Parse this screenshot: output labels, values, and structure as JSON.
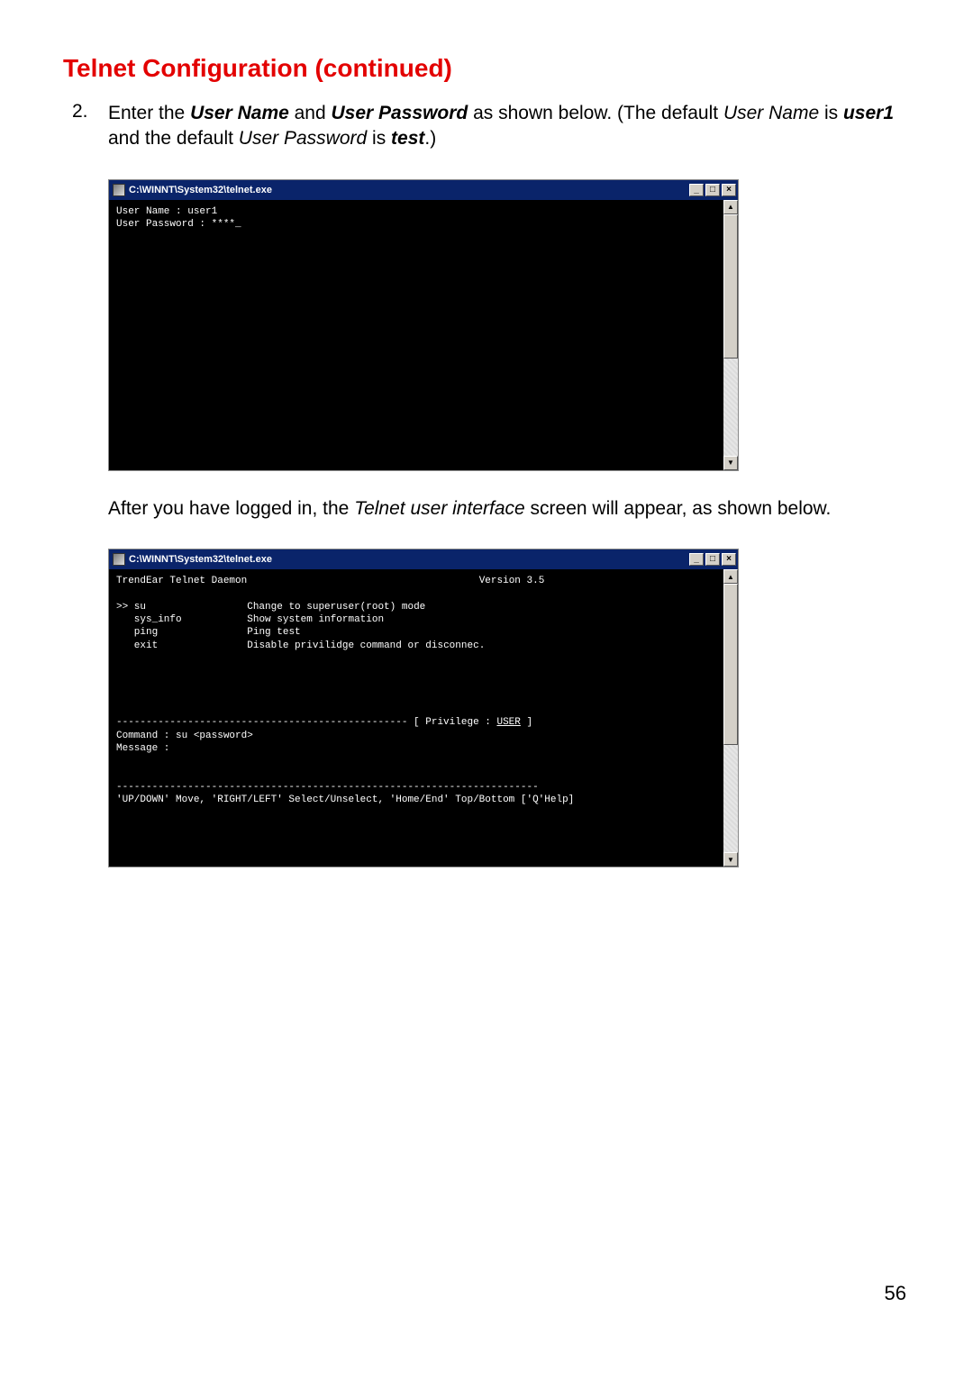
{
  "heading": "Telnet Configuration (continued)",
  "step_num": "2.",
  "step_text_parts": {
    "t1": "Enter the ",
    "b1": "User Name",
    "t2": " and ",
    "b2": "User Password",
    "t3": " as shown below. (The default ",
    "i1": "User Name",
    "t4": " is ",
    "bi1": "user1",
    "t5": " and the default ",
    "i2": "User Password",
    "t6": " is ",
    "bi2": "test",
    "t7": ".)"
  },
  "window1": {
    "title": "C:\\WINNT\\System32\\telnet.exe",
    "lines": {
      "l1": "User Name : user1",
      "l2": "User Password : ****_"
    }
  },
  "para_parts": {
    "t1": "After you have logged in, the ",
    "i1": "Telnet user interface",
    "t2": " screen will appear, as shown below."
  },
  "window2": {
    "title": "C:\\WINNT\\System32\\telnet.exe",
    "header_left": "TrendEar Telnet Daemon",
    "header_right": "Version 3.5",
    "cmds": {
      "c1": ">> su",
      "d1": "Change to superuser(root) mode",
      "c2": "   sys_info",
      "d2": "Show system information",
      "c3": "   ping",
      "d3": "Ping test",
      "c4": "   exit",
      "d4": "Disable privilidge command or disconnec."
    },
    "priv_line": "------------------------------------------------- [ Privilege : ",
    "priv_value": "USER",
    "priv_end": " ]",
    "cmd_line": "Command : su <password>",
    "msg_line": "Message :",
    "help_line": "'UP/DOWN' Move, 'RIGHT/LEFT' Select/Unselect, 'Home/End' Top/Bottom ['Q'Help]"
  },
  "page_number": "56",
  "winbtns": {
    "min": "_",
    "max": "□",
    "close": "×"
  },
  "scroll": {
    "up": "▲",
    "down": "▼"
  }
}
